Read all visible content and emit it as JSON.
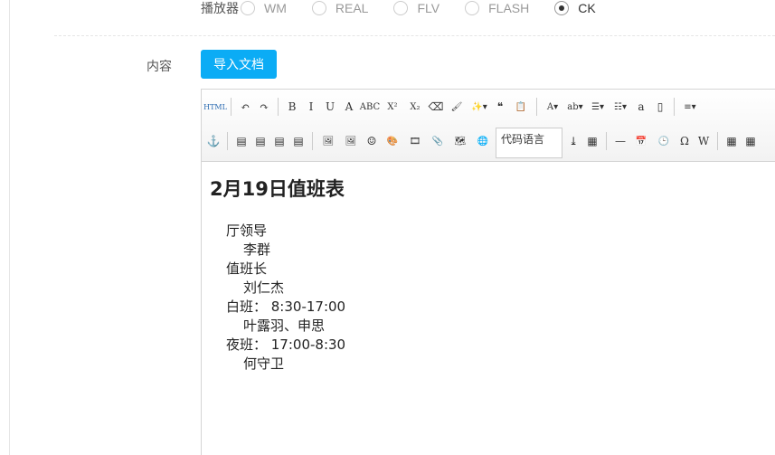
{
  "player": {
    "label": "播放器",
    "options": [
      {
        "label": "WM",
        "selected": false
      },
      {
        "label": "REAL",
        "selected": false
      },
      {
        "label": "FLV",
        "selected": false
      },
      {
        "label": "FLASH",
        "selected": false
      },
      {
        "label": "CK",
        "selected": true
      }
    ]
  },
  "content_label": "内容",
  "import_button": "导入文档",
  "accent": "#0bacf5",
  "toolbar": {
    "row1": [
      {
        "name": "html-icon",
        "g": "HTML"
      },
      {
        "sep": true
      },
      {
        "name": "undo-icon",
        "g": "↶"
      },
      {
        "name": "redo-icon",
        "g": "↷"
      },
      {
        "sep": true
      },
      {
        "name": "bold-icon",
        "g": "B"
      },
      {
        "name": "italic-icon",
        "g": "I"
      },
      {
        "name": "underline-icon",
        "g": "U"
      },
      {
        "name": "font-border-icon",
        "g": "A"
      },
      {
        "name": "strikethrough-icon",
        "g": "ABC"
      },
      {
        "name": "superscript-icon",
        "g": "X²"
      },
      {
        "name": "subscript-icon",
        "g": "X₂"
      },
      {
        "name": "eraser-icon",
        "g": "⌫"
      },
      {
        "name": "format-brush-icon",
        "g": "🖌"
      },
      {
        "name": "auto-format-icon",
        "g": "✨▾"
      },
      {
        "name": "blockquote-icon",
        "g": "❝"
      },
      {
        "name": "paste-text-icon",
        "g": "📋"
      },
      {
        "sep": true
      },
      {
        "name": "font-color-icon",
        "g": "A▾"
      },
      {
        "name": "highlight-icon",
        "g": "ab▾"
      },
      {
        "name": "ordered-list-icon",
        "g": "☰▾"
      },
      {
        "name": "unordered-list-icon",
        "g": "☷▾"
      },
      {
        "name": "select-all-icon",
        "g": "a"
      },
      {
        "name": "clear-doc-icon",
        "g": "▯"
      },
      {
        "sep": true
      },
      {
        "name": "line-height-icon",
        "g": "≡▾"
      }
    ],
    "row2": [
      {
        "name": "anchor-icon",
        "g": "⚓"
      },
      {
        "sep": true
      },
      {
        "name": "image-left-icon",
        "g": "▤"
      },
      {
        "name": "image-right-icon",
        "g": "▤"
      },
      {
        "name": "image-none-icon",
        "g": "▤"
      },
      {
        "name": "image-center-icon",
        "g": "▤"
      },
      {
        "sep": true
      },
      {
        "name": "image-icon",
        "g": "🖼"
      },
      {
        "name": "multi-image-icon",
        "g": "🖼"
      },
      {
        "name": "emotion-icon",
        "g": "☺"
      },
      {
        "name": "scrawl-icon",
        "g": "🎨"
      },
      {
        "name": "video-icon",
        "g": "🎞"
      },
      {
        "name": "attachment-icon",
        "g": "📎"
      },
      {
        "name": "map-icon",
        "g": "🗺"
      },
      {
        "name": "web-icon",
        "g": "🌐"
      },
      {
        "select": true,
        "label": "代码语言"
      },
      {
        "name": "page-break-icon",
        "g": "⤓"
      },
      {
        "name": "template-icon",
        "g": "▦"
      },
      {
        "sep": true
      },
      {
        "name": "horizontal-rule-icon",
        "g": "—"
      },
      {
        "name": "date-icon",
        "g": "📅"
      },
      {
        "name": "time-icon",
        "g": "🕒"
      },
      {
        "name": "special-char-icon",
        "g": "Ω"
      },
      {
        "name": "word-image-icon",
        "g": "W"
      },
      {
        "sep": true
      },
      {
        "name": "table-icon",
        "g": "▦"
      },
      {
        "name": "table-insert-icon",
        "g": "▦"
      }
    ]
  },
  "doc": {
    "title": "2月19日值班表",
    "lines": [
      {
        "t": "厅领导",
        "i": false
      },
      {
        "t": "李群",
        "i": true
      },
      {
        "t": "值班长",
        "i": false
      },
      {
        "t": "刘仁杰",
        "i": true
      },
      {
        "t": "白班： 8:30-17:00",
        "i": false
      },
      {
        "t": "叶露羽、申思",
        "i": true
      },
      {
        "t": "夜班： 17:00-8:30",
        "i": false
      },
      {
        "t": "何守卫",
        "i": true
      }
    ]
  }
}
